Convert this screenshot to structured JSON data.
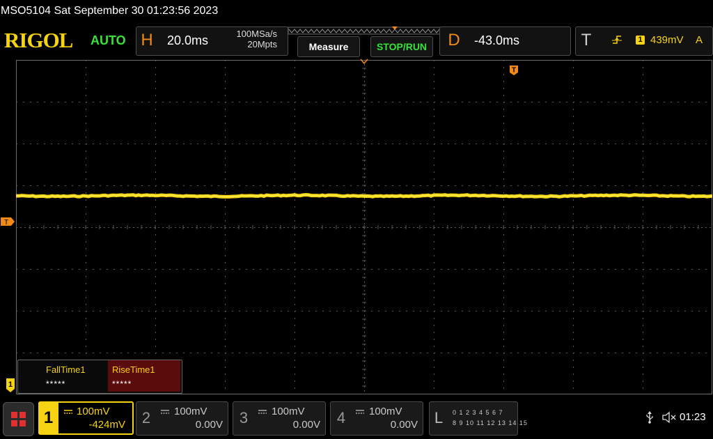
{
  "title": "MSO5104  Sat September 30 01:23:56 2023",
  "brand": "RIGOL",
  "trigger_mode": "AUTO",
  "horizontal": {
    "letter": "H",
    "timebase": "20.0ms",
    "sample_rate": "100MSa/s",
    "memory_depth": "20Mpts"
  },
  "buttons": {
    "measure": "Measure",
    "stop_run": "STOP/RUN"
  },
  "delay": {
    "letter": "D",
    "value": "-43.0ms"
  },
  "trigger": {
    "letter": "T",
    "source": "1",
    "level": "439mV",
    "coupling": "A",
    "marker_label": "T"
  },
  "measurements": [
    {
      "name": "FallTime1",
      "value": "*****"
    },
    {
      "name": "RiseTime1",
      "value": "*****"
    }
  ],
  "channels": [
    {
      "number": "1",
      "scale": "100mV",
      "offset": "-424mV",
      "active": true
    },
    {
      "number": "2",
      "scale": "100mV",
      "offset": "0.00V",
      "active": false
    },
    {
      "number": "3",
      "scale": "100mV",
      "offset": "0.00V",
      "active": false
    },
    {
      "number": "4",
      "scale": "100mV",
      "offset": "0.00V",
      "active": false
    }
  ],
  "logic_analyzer": {
    "letter": "L",
    "row1": "0 1 2 3  4 5 6 7",
    "row2": "8 9 10 11 12 13 14 15"
  },
  "clock": "01:23",
  "icons": {
    "menu": "menu-grid-icon",
    "usb": "usb-icon",
    "sound": "speaker-muted-icon"
  },
  "colors": {
    "ch1": "#f5d312",
    "orange": "#f08a14",
    "green": "#37e23a",
    "rise_bg": "#5a0b0b"
  },
  "waveform": {
    "level_divisions_above_center": 0.75,
    "description_free": true
  }
}
